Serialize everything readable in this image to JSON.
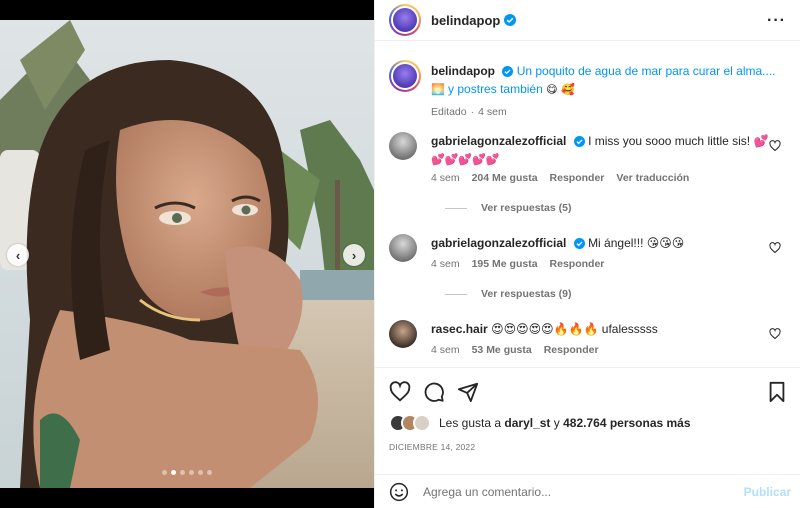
{
  "post": {
    "author": "belindapop",
    "more_icon": "more-options-icon"
  },
  "carousel": {
    "dot_count": 6,
    "active_index": 1
  },
  "caption": {
    "username": "belindapop",
    "text_line1": "Un poquito de agua de mar para curar el alma....",
    "text_line2_emoji": "🌅",
    "text_line2": "y postres también",
    "text_line2_end": "😋 🥰",
    "edited": "Editado",
    "age": "4 sem"
  },
  "comments": [
    {
      "username": "gabrielagonzalezofficial",
      "text": "I miss you sooo much little sis! 💕",
      "text2": "💕💕💕💕💕",
      "age": "4 sem",
      "likes": "204 Me gusta",
      "reply": "Responder",
      "translate": "Ver traducción",
      "replies": "Ver respuestas (5)"
    },
    {
      "username": "gabrielagonzalezofficial",
      "text": "Mi ángel!!! 😘😘😘",
      "age": "4 sem",
      "likes": "195 Me gusta",
      "reply": "Responder",
      "replies": "Ver respuestas (9)"
    },
    {
      "username": "rasec.hair",
      "text": "😍😍😍😍😍🔥🔥🔥 ufalesssss",
      "age": "4 sem",
      "likes": "53 Me gusta",
      "reply": "Responder"
    }
  ],
  "likes": {
    "prefix": "Les gusta a",
    "user": "daryl_st",
    "connector": "y",
    "count": "482.764 personas más"
  },
  "date": "DICIEMBRE 14, 2022",
  "composer": {
    "placeholder": "Agrega un comentario...",
    "publish": "Publicar"
  },
  "colors": {
    "verified": "#0095f6",
    "muted": "#737373",
    "publish_disabled": "#b2dffc"
  }
}
